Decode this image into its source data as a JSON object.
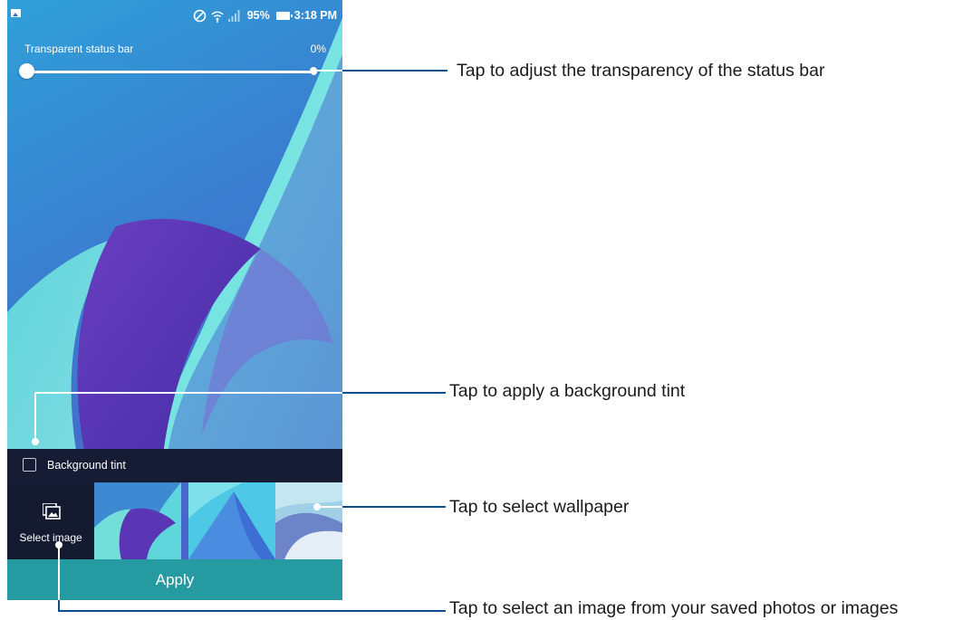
{
  "status_bar": {
    "battery_percent": "95%",
    "time": "3:18 PM",
    "icons": [
      "picture-icon",
      "do-not-disturb-icon",
      "wifi-icon",
      "signal-icon",
      "battery-icon"
    ]
  },
  "slider": {
    "label": "Transparent status bar",
    "value_text": "0%",
    "value": 0
  },
  "tint": {
    "label": "Background tint",
    "checked": false
  },
  "select_image": {
    "label": "Select image",
    "icon": "gallery-icon"
  },
  "wallpapers": [
    "wallpaper-thumbnail-1",
    "wallpaper-thumbnail-2",
    "wallpaper-thumbnail-3"
  ],
  "apply": {
    "label": "Apply"
  },
  "callouts": {
    "status_bar": "Tap to adjust the transparency of the status bar",
    "tint": "Tap to apply a background tint",
    "wallpaper": "Tap to select wallpaper",
    "image": "Tap to select an image from your saved photos or images"
  },
  "colors": {
    "apply_bar": "#269aa1",
    "tint_bar": "#151c33",
    "callout_line": "#0b4f8a"
  }
}
